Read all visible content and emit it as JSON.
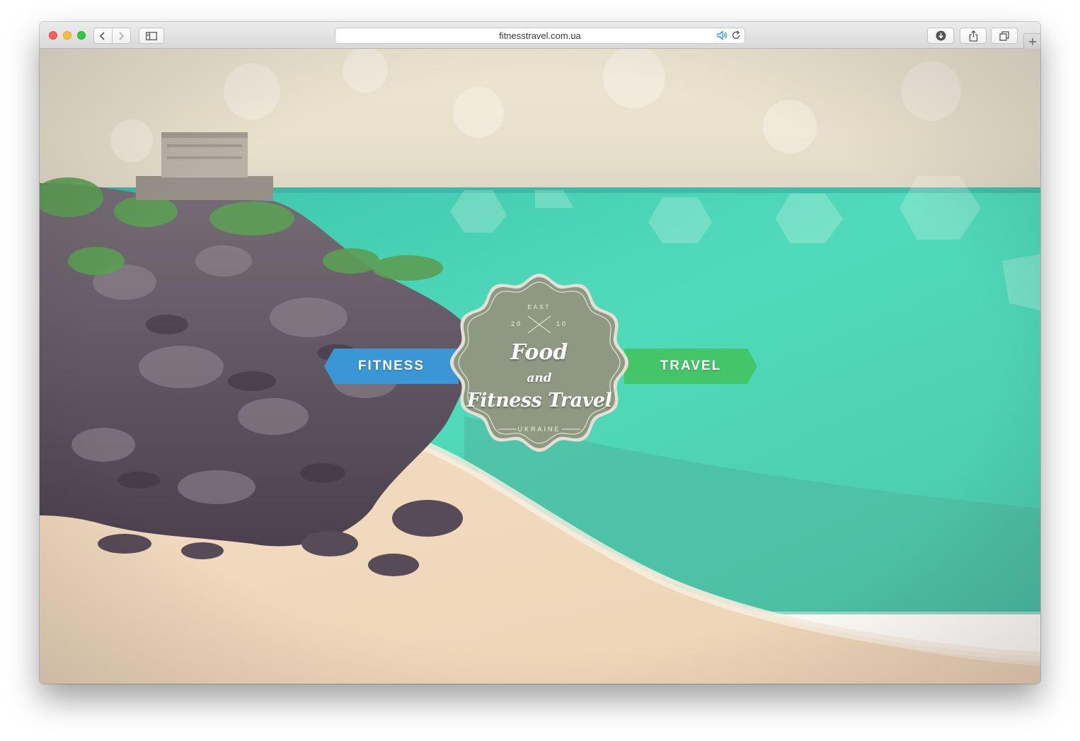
{
  "browser": {
    "url": "fitnesstravel.com.ua",
    "icons": {
      "back": "chevron-left-icon",
      "forward": "chevron-right-icon",
      "sidebar": "sidebar-icon",
      "sound": "speaker-icon",
      "reload": "reload-icon",
      "downloads": "download-icon",
      "share": "share-icon",
      "tabs": "tabs-icon",
      "new_tab": "plus-icon"
    }
  },
  "hero": {
    "left_ribbon": "FITNESS",
    "right_ribbon": "TRAVEL",
    "badge": {
      "top": "EAST",
      "year_left": "20",
      "year_right": "10",
      "line1": "Food",
      "line2": "and",
      "line3": "Fitness Travel",
      "bottom": "UKRAINE"
    }
  },
  "colors": {
    "fitness_ribbon": "#3a96d5",
    "travel_ribbon": "#45c56a",
    "badge": "#8f9883",
    "sea": "#3fd3b4",
    "sand": "#f1dcc1"
  }
}
